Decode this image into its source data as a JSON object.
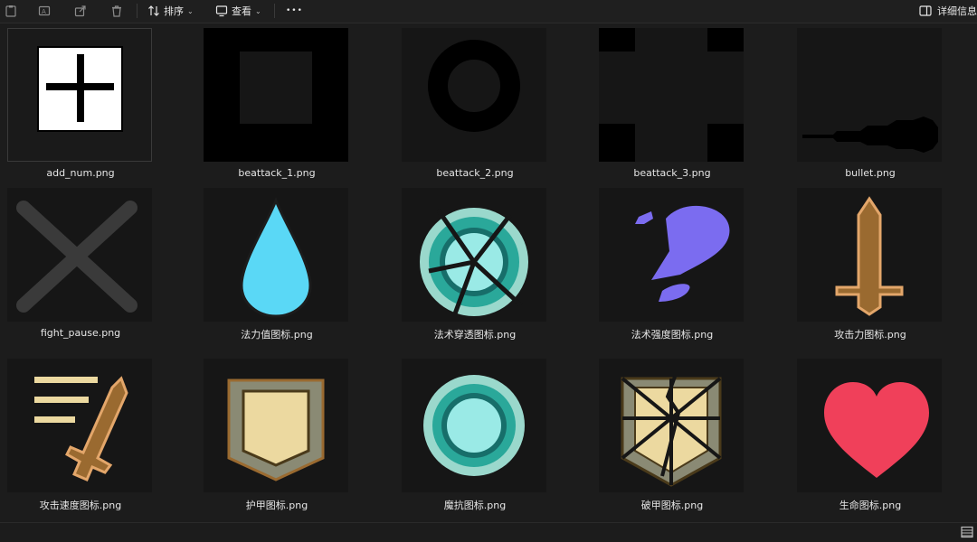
{
  "toolbar": {
    "sort_label": "排序",
    "view_label": "查看",
    "more_label": "•••",
    "details_label": "详细信息"
  },
  "files": [
    {
      "name": "add_num.png",
      "icon": "add-plus-image"
    },
    {
      "name": "beattack_1.png",
      "icon": "square-frame-image"
    },
    {
      "name": "beattack_2.png",
      "icon": "ring-image"
    },
    {
      "name": "beattack_3.png",
      "icon": "corner-squares-image"
    },
    {
      "name": "bullet.png",
      "icon": "bullet-image"
    },
    {
      "name": "fight_pause.png",
      "icon": "x-image"
    },
    {
      "name": "法力值图标.png",
      "icon": "drop-image"
    },
    {
      "name": "法术穿透图标.png",
      "icon": "broken-shield-circle-image"
    },
    {
      "name": "法术强度图标.png",
      "icon": "purple-blob-image"
    },
    {
      "name": "攻击力图标.png",
      "icon": "sword-image"
    },
    {
      "name": "攻击速度图标.png",
      "icon": "fast-sword-image"
    },
    {
      "name": "护甲图标.png",
      "icon": "armor-shield-image"
    },
    {
      "name": "魔抗图标.png",
      "icon": "magic-resist-circle-image"
    },
    {
      "name": "破甲图标.png",
      "icon": "broken-armor-image"
    },
    {
      "name": "生命图标.png",
      "icon": "heart-image"
    }
  ],
  "colors": {
    "background": "#1c1c1c",
    "drop_blue": "#5ad8f6",
    "teal": "#2aa89a",
    "purple": "#7b6cf0",
    "bronze": "#9a6a30",
    "heart": "#f0405a",
    "parchment": "#ecd9a0"
  }
}
